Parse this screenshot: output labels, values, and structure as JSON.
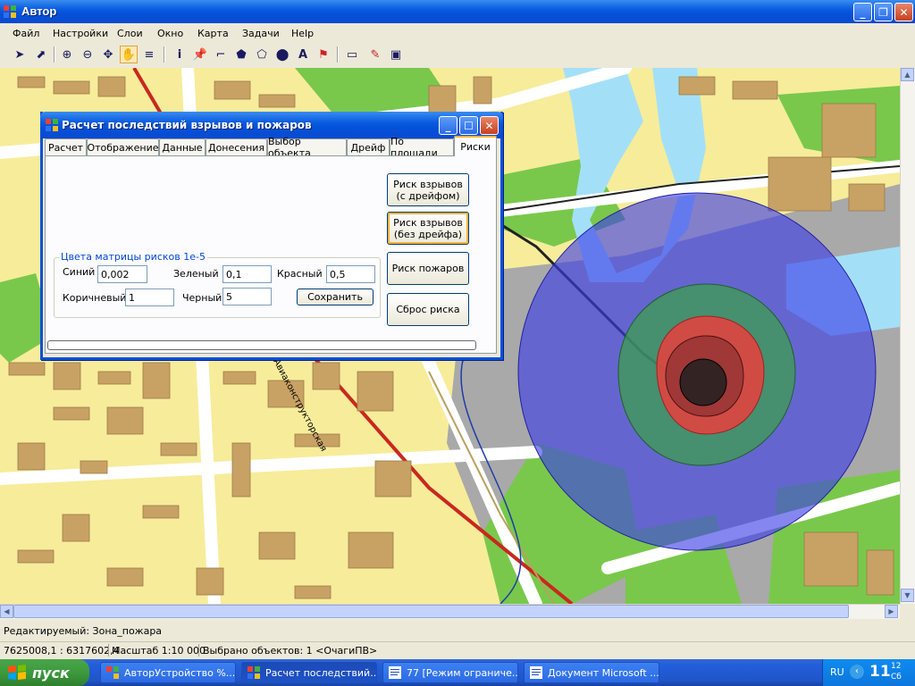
{
  "window": {
    "title": "Автор"
  },
  "menu": [
    "Файл",
    "Настройки",
    "Слои",
    "Окно",
    "Карта",
    "Задачи",
    "Help"
  ],
  "map": {
    "street_label": "Авиаконструкторская"
  },
  "dialog": {
    "title": "Расчет последствий взрывов и пожаров",
    "tabs": [
      "Расчет",
      "Отображение",
      "Данные",
      "Донесения",
      "Выбор объекта",
      "Дрейф",
      "По площади",
      "Риски"
    ],
    "active_tab": "Риски",
    "buttons": {
      "risk_explosion_drift": "Риск взрывов (с дрейфом)",
      "risk_explosion_nodrift": "Риск взрывов (без дрейфа)",
      "risk_fire": "Риск пожаров",
      "reset_risk": "Сброс риска",
      "save": "Сохранить"
    },
    "group_title": "Цвета матрицы рисков 1е-5",
    "fields": {
      "blue": {
        "label": "Синий",
        "value": "0,002"
      },
      "green": {
        "label": "Зеленый",
        "value": "0,1"
      },
      "red": {
        "label": "Красный",
        "value": "0,5"
      },
      "brown": {
        "label": "Коричневый",
        "value": "1"
      },
      "black": {
        "label": "Черный",
        "value": "5"
      }
    },
    "progress": 0
  },
  "status": {
    "editing": "Редактируемый: Зона_пожара",
    "coords": "7625008,1 : 6317602,4",
    "scale": "Масштаб 1:10 000",
    "selected": "Выбрано объектов: 1 <ОчагиПВ>"
  },
  "taskbar": {
    "start": "пуск",
    "tasks": [
      "АвторУстройство %...",
      "Расчет последствий...",
      "77 [Режим ограниче...",
      "Документ Microsoft ..."
    ],
    "active_task": 1,
    "lang": "RU",
    "time_hour": "11",
    "time_min": "12",
    "day": "Сб"
  },
  "colors": {
    "xp_blue": "#0a5ce0",
    "risk_blue": "#3c3ce8",
    "risk_green": "#3aa04a",
    "risk_red": "#f03c3c",
    "risk_black": "#202020"
  },
  "icons": [
    "app-icon",
    "arrow-select-icon",
    "zoom-in-icon",
    "zoom-out-icon",
    "pan-icon",
    "hand-icon",
    "layers-icon",
    "info-icon",
    "pin-icon",
    "polyline-icon",
    "polygon-icon",
    "circle-icon",
    "text-icon",
    "flag-icon",
    "ruler-icon",
    "query-icon",
    "image-icon"
  ]
}
